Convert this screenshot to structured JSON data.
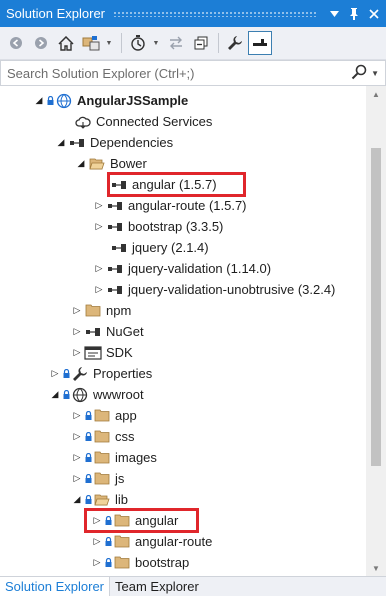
{
  "window": {
    "title": "Solution Explorer",
    "menu_icon": "dropdown-arrow-icon",
    "pin_icon": "pin-icon",
    "close_icon": "close-icon"
  },
  "search": {
    "placeholder": "Search Solution Explorer (Ctrl+;)"
  },
  "tree": {
    "items": [
      {
        "label": "AngularJSSample",
        "icon": "web-project-icon"
      },
      {
        "label": "Connected Services",
        "icon": "cloud-icon"
      },
      {
        "label": "Dependencies",
        "icon": "dependencies-icon"
      },
      {
        "label": "Bower",
        "icon": "folder-open-icon"
      },
      {
        "label": "angular (1.5.7)",
        "icon": "package-icon"
      },
      {
        "label": "angular-route (1.5.7)",
        "icon": "package-icon"
      },
      {
        "label": "bootstrap (3.3.5)",
        "icon": "package-icon"
      },
      {
        "label": "jquery (2.1.4)",
        "icon": "package-icon"
      },
      {
        "label": "jquery-validation (1.14.0)",
        "icon": "package-icon"
      },
      {
        "label": "jquery-validation-unobtrusive (3.2.4)",
        "icon": "package-icon"
      },
      {
        "label": "npm",
        "icon": "folder-icon"
      },
      {
        "label": "NuGet",
        "icon": "package-icon"
      },
      {
        "label": "SDK",
        "icon": "sdk-icon"
      },
      {
        "label": "Properties",
        "icon": "wrench-icon"
      },
      {
        "label": "wwwroot",
        "icon": "globe-icon"
      },
      {
        "label": "app",
        "icon": "folder-icon"
      },
      {
        "label": "css",
        "icon": "folder-icon"
      },
      {
        "label": "images",
        "icon": "folder-icon"
      },
      {
        "label": "js",
        "icon": "folder-icon"
      },
      {
        "label": "lib",
        "icon": "folder-open-icon"
      },
      {
        "label": "angular",
        "icon": "folder-icon"
      },
      {
        "label": "angular-route",
        "icon": "folder-icon"
      },
      {
        "label": "bootstrap",
        "icon": "folder-icon"
      }
    ]
  },
  "tabs": [
    {
      "label": "Solution Explorer"
    },
    {
      "label": "Team Explorer"
    }
  ],
  "colors": {
    "title_bar": "#1c7ed6",
    "highlight": "#e0262b",
    "folder": "#dcb67a",
    "lock": "#1f6fd1"
  }
}
